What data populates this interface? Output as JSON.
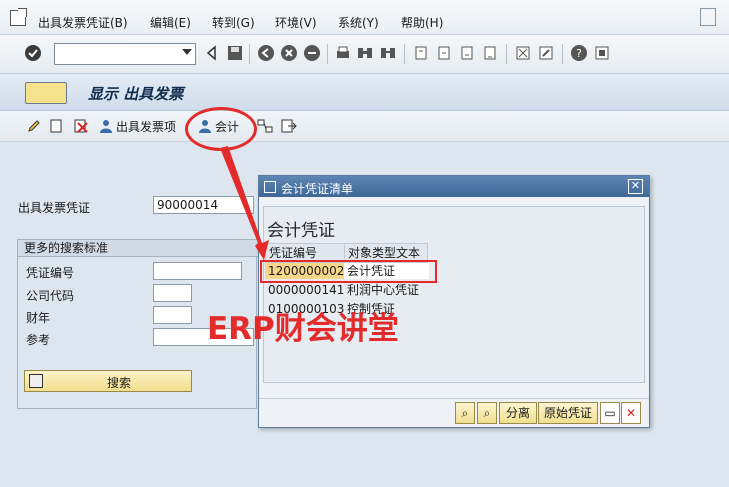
{
  "menu": {
    "items": [
      "出具发票凭证(B)",
      "编辑(E)",
      "转到(G)",
      "环境(V)",
      "系统(Y)",
      "帮助(H)"
    ]
  },
  "toolbar": {
    "command_field_value": ""
  },
  "title": {
    "text": "显示 出具发票"
  },
  "app_toolbar": {
    "invoice_items_label": "出具发票项",
    "accounting_label": "会计"
  },
  "form": {
    "invoice_doc_label": "出具发票凭证",
    "invoice_doc_value": "90000014"
  },
  "more_search": {
    "title": "更多的搜索标准",
    "fields": [
      "凭证编号",
      "公司代码",
      "财年",
      "参考"
    ],
    "search_button": "搜索"
  },
  "dialog": {
    "title": "会计凭证清单",
    "heading": "会计凭证",
    "columns": [
      "凭证编号",
      "对象类型文本"
    ],
    "rows": [
      {
        "doc": "1200000002",
        "type": "会计凭证"
      },
      {
        "doc": "0000000141",
        "type": "利润中心凭证"
      },
      {
        "doc": "0100000103",
        "type": "控制凭证"
      }
    ],
    "buttons": {
      "split": "分离",
      "original": "原始凭证"
    }
  },
  "watermark": {
    "text": "ERP财会讲堂"
  },
  "colors": {
    "annotation_red": "#e42b2b",
    "highlight_row": "#f6d78a",
    "dialog_title": "#3d6796"
  }
}
